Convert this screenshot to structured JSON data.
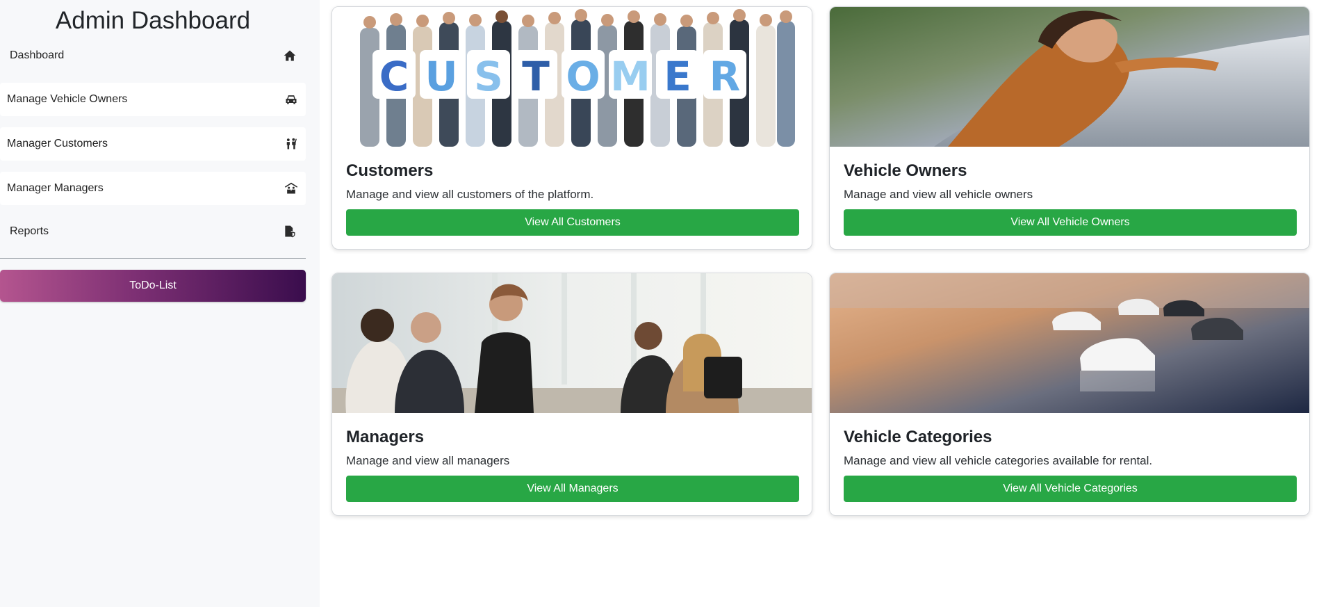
{
  "sidebar": {
    "title": "Admin Dashboard",
    "items": [
      {
        "label": "Dashboard",
        "icon": "home-icon"
      },
      {
        "label": "Manage Vehicle Owners",
        "icon": "car-icon"
      },
      {
        "label": "Manager Customers",
        "icon": "people-icon"
      },
      {
        "label": "Manager Managers",
        "icon": "person-shelter-icon"
      },
      {
        "label": "Reports",
        "icon": "file-shield-icon"
      }
    ],
    "todo_label": "ToDo-List"
  },
  "cards": [
    {
      "title": "Customers",
      "description": "Manage and view all customers of the platform.",
      "button": "View All Customers",
      "image_word": "CUSTOMER"
    },
    {
      "title": "Vehicle Owners",
      "description": "Manage and view all vehicle owners",
      "button": "View All Vehicle Owners"
    },
    {
      "title": "Managers",
      "description": "Manage and view all managers",
      "button": "View All Managers"
    },
    {
      "title": "Vehicle Categories",
      "description": "Manage and view all vehicle categories available for rental.",
      "button": "View All Vehicle Categories"
    }
  ],
  "colors": {
    "button_green": "#28a745",
    "todo_gradient_start": "#b4558f",
    "todo_gradient_end": "#3a0d4d",
    "sidebar_bg": "#f7f8fa"
  }
}
